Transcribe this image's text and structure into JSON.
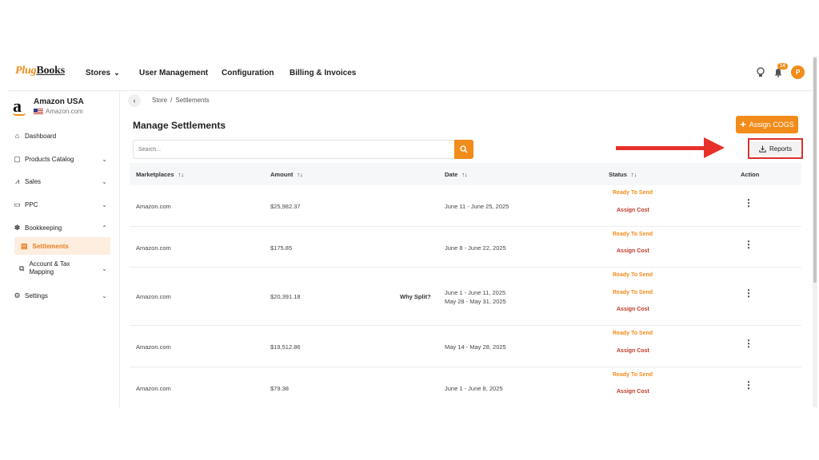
{
  "logo": {
    "part1": "Plug",
    "part2": "Books"
  },
  "nav": {
    "stores": "Stores",
    "user_management": "User Management",
    "configuration": "Configuration",
    "billing": "Billing & Invoices",
    "notification_count": "14",
    "avatar_initial": "P"
  },
  "store": {
    "name": "Amazon USA",
    "marketplace": "Amazon.com"
  },
  "sidebar": {
    "items": [
      {
        "label": "Dashboard",
        "icon": "home-icon"
      },
      {
        "label": "Products Catalog",
        "icon": "box-icon"
      },
      {
        "label": "Sales",
        "icon": "chart-icon"
      },
      {
        "label": "PPC",
        "icon": "card-icon"
      },
      {
        "label": "Bookkeeping",
        "icon": "gear-icon"
      },
      {
        "label": "Settlements",
        "icon": "document-icon"
      },
      {
        "label": "Account & Tax Mapping",
        "icon": "sitemap-icon"
      },
      {
        "label": "Settings",
        "icon": "settings-icon"
      }
    ]
  },
  "breadcrumb": {
    "store": "Store",
    "sep": "/",
    "current": "Settlements"
  },
  "page": {
    "title": "Manage Settlements",
    "assign_cogs": "Assign COGS",
    "search_placeholder": "Search...",
    "reports": "Reports"
  },
  "table": {
    "headers": {
      "marketplace": "Marketplaces",
      "amount": "Amount",
      "date": "Date",
      "status": "Status",
      "action": "Action"
    },
    "ready_label": "Ready To Send",
    "assign_label": "Assign Cost",
    "why_split": "Why Split?",
    "rows": [
      {
        "marketplace": "Amazon.com",
        "amount": "$25,982.37",
        "date1": "June 11 - June 25, 2025"
      },
      {
        "marketplace": "Amazon.com",
        "amount": "$175.85",
        "date1": "June 8 - June 22, 2025"
      },
      {
        "marketplace": "Amazon.com",
        "amount": "$20,391.18",
        "date1": "June 1 - June 11, 2025",
        "date2": "May 28 - May 31, 2025"
      },
      {
        "marketplace": "Amazon.com",
        "amount": "$19,512.86",
        "date1": "May 14 - May 28, 2025"
      },
      {
        "marketplace": "Amazon.com",
        "amount": "$79.38",
        "date1": "June 1 - June 8, 2025"
      }
    ]
  },
  "colors": {
    "accent": "#f28c1a",
    "danger": "#c0392b",
    "arrow": "#e8302a"
  }
}
